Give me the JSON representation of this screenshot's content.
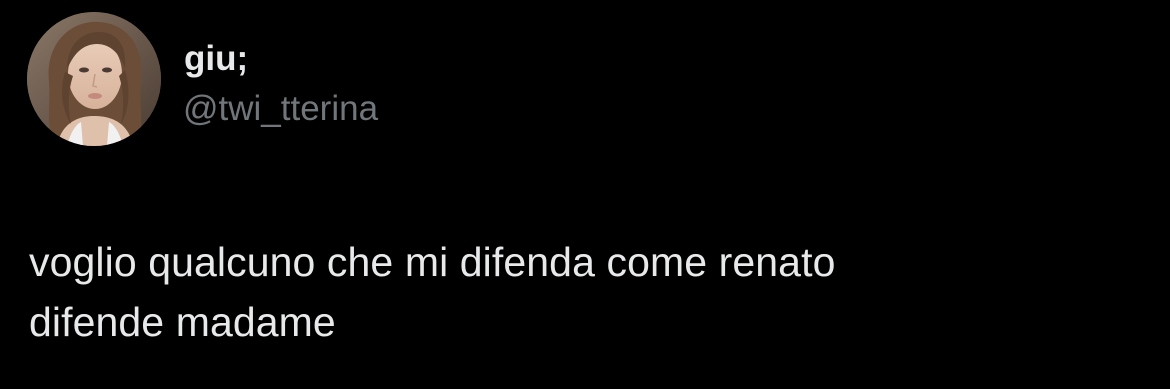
{
  "tweet": {
    "author": {
      "display_name": "giu;",
      "handle": "@twi_tterina",
      "avatar_icon": "profile-photo-avatar"
    },
    "text_lines": [
      "voglio qualcuno che mi difenda come renato",
      "difende madame"
    ]
  },
  "theme": {
    "background": "#000000",
    "primary_text": "#e7e9ea",
    "secondary_text": "#71767b"
  }
}
